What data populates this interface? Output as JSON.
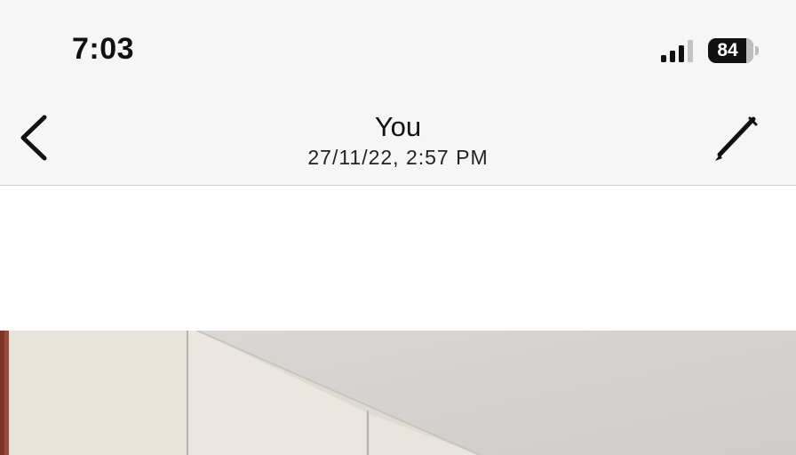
{
  "status_bar": {
    "time": "7:03",
    "signal_icon": "cellular-signal-icon",
    "battery_level": "84",
    "battery_fraction": 0.84
  },
  "header": {
    "back_icon": "chevron-left-icon",
    "title": "You",
    "subtitle": "27/11/22, 2:57 PM",
    "edit_icon": "pencil-icon"
  },
  "media": {
    "content": "photo"
  },
  "colors": {
    "chrome_background": "#f6f6f6",
    "divider": "#cfcfcf",
    "text": "#111111",
    "content_background": "#ffffff"
  }
}
